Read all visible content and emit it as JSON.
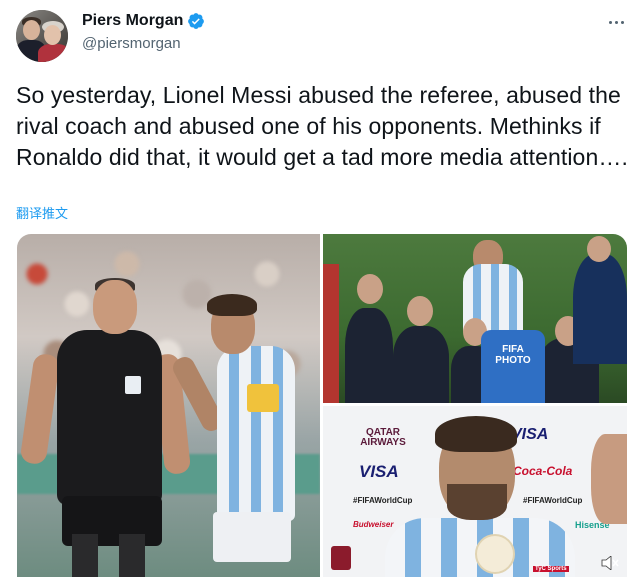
{
  "tweet": {
    "display_name": "Piers Morgan",
    "handle": "@piersmorgan",
    "verified": true,
    "text": "So yesterday, Lionel Messi abused the referee, abused the rival coach and abused one of his opponents. Methinks if Ronaldo did that, it would get a tad more media attention….",
    "translate_label": "翻译推文",
    "more_icon": "more-horizontal-icon",
    "verified_icon": "verified-badge-icon"
  },
  "colors": {
    "link": "#1d9bf0",
    "secondary_text": "#536471",
    "primary_text": "#0f1419",
    "verified": "#1d9bf0"
  },
  "media": {
    "photo_top_right": {
      "vest_label": "FIFA\nPHOTO"
    },
    "photo_bottom_right": {
      "sponsors": [
        "QATAR AIRWAYS",
        "VISA",
        "VISA",
        "#FIFAWorldCup",
        "Coca-Cola",
        "#FIFAWorldCup",
        "Budweiser",
        "Hisense",
        "TyC Sports"
      ]
    }
  }
}
